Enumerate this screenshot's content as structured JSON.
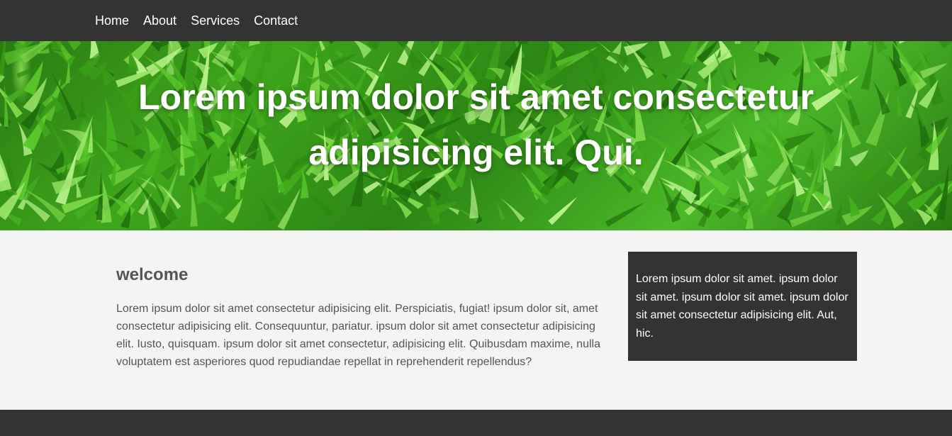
{
  "nav": {
    "items": [
      {
        "label": "Home"
      },
      {
        "label": "About"
      },
      {
        "label": "Services"
      },
      {
        "label": "Contact"
      }
    ]
  },
  "hero": {
    "title": "Lorem ipsum dolor sit amet consectetur adipisicing elit. Qui."
  },
  "main": {
    "heading": "welcome",
    "body": "Lorem ipsum dolor sit amet consectetur adipisicing elit. Perspiciatis, fugiat! ipsum dolor sit, amet consectetur adipisicing elit. Consequuntur, pariatur. ipsum dolor sit amet consectetur adipisicing elit. Iusto, quisquam. ipsum dolor sit amet consectetur, adipisicing elit. Quibusdam maxime, nulla voluptatem est asperiores quod repudiandae repellat in reprehenderit repellendus?"
  },
  "sidebar": {
    "text": "Lorem ipsum dolor sit amet. ipsum dolor sit amet. ipsum dolor sit amet. ipsum dolor sit amet consectetur adipisicing elit. Aut, hic."
  },
  "colors": {
    "dark": "#333333",
    "background": "#f4f4f4",
    "text": "#555555",
    "grass": "#3fa61c"
  }
}
